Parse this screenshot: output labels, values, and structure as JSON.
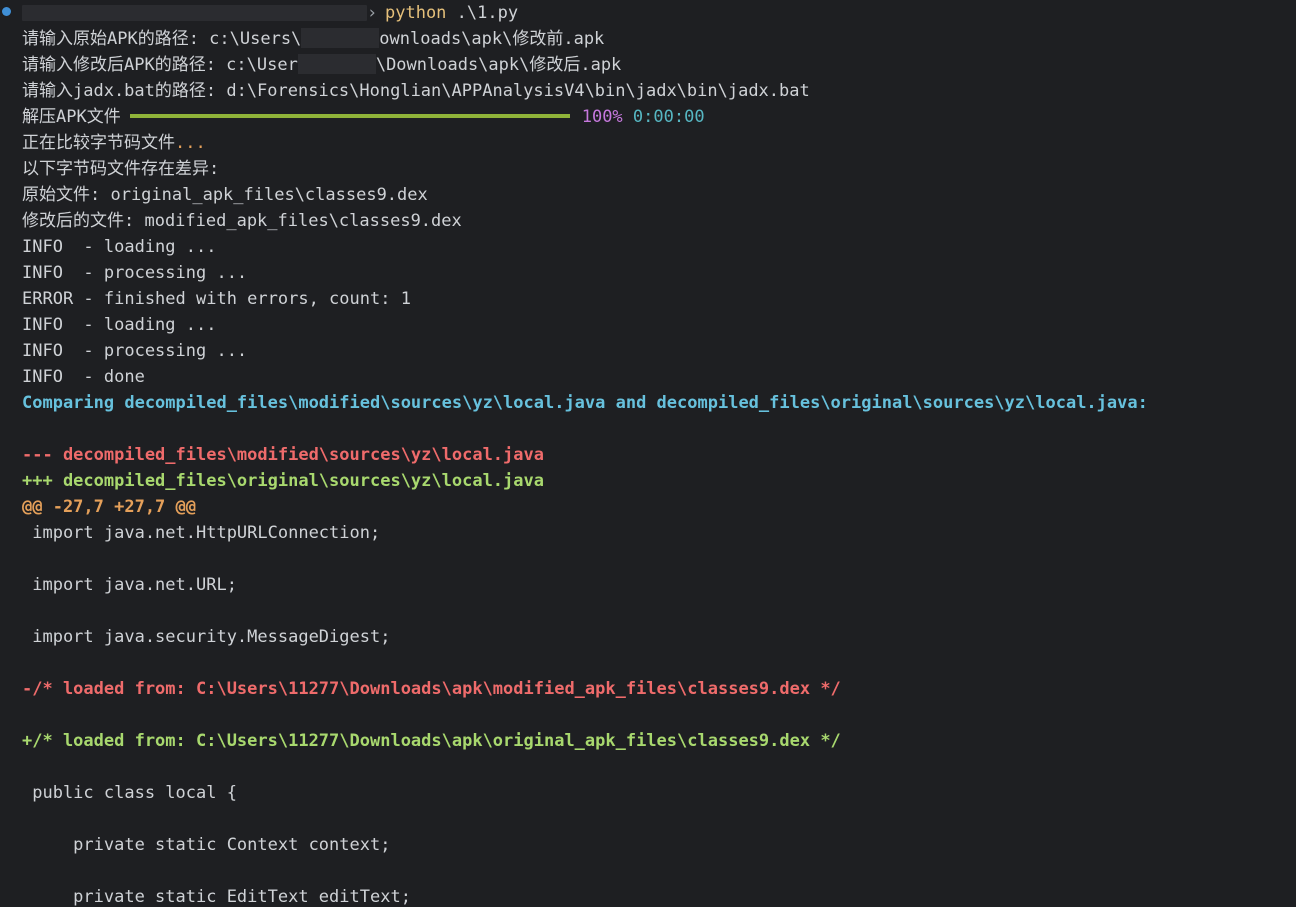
{
  "prompt": {
    "command_exe": "python",
    "command_args": " .\\1.py"
  },
  "inputs": {
    "original_label": "请输入原始APK的路径: c:\\Users\\",
    "original_tail": "ownloads\\apk\\修改前.apk",
    "modified_label": "请输入修改后APK的路径: c:\\User",
    "modified_tail": "\\Downloads\\apk\\修改后.apk",
    "jadx_line": "请输入jadx.bat的路径: d:\\Forensics\\Honglian\\APPAnalysisV4\\bin\\jadx\\bin\\jadx.bat"
  },
  "progress": {
    "label": "解压APK文件",
    "percent_text": "100%",
    "elapsed": "0:00:00",
    "fraction": 1.0
  },
  "status": {
    "comparing_text": "正在比较字节码文件",
    "comparing_ellipsis": "...",
    "diff_found": "以下字节码文件存在差异:",
    "original_file": "原始文件: original_apk_files\\classes9.dex",
    "modified_file": "修改后的文件: modified_apk_files\\classes9.dex"
  },
  "log": [
    "INFO  - loading ...",
    "INFO  - processing ...",
    "ERROR - finished with errors, count: 1",
    "INFO  - loading ...",
    "INFO  - processing ...",
    "INFO  - done"
  ],
  "diff": {
    "comparing_header": "Comparing decompiled_files\\modified\\sources\\yz\\local.java and decompiled_files\\original\\sources\\yz\\local.java:",
    "minus_file": "--- decompiled_files\\modified\\sources\\yz\\local.java",
    "plus_file": "+++ decompiled_files\\original\\sources\\yz\\local.java",
    "hunk": "@@ -27,7 +27,7 @@",
    "ctx1": " import java.net.HttpURLConnection;",
    "ctx2": " import java.net.URL;",
    "ctx3": " import java.security.MessageDigest;",
    "removed": "-/* loaded from: C:\\Users\\11277\\Downloads\\apk\\modified_apk_files\\classes9.dex */",
    "added": "+/* loaded from: C:\\Users\\11277\\Downloads\\apk\\original_apk_files\\classes9.dex */",
    "ctx4": " public class local {",
    "ctx5": "     private static Context context;",
    "ctx6": "     private static EditText editText;"
  },
  "colors": {
    "background": "#1e1f22",
    "text": "#cfd2d6",
    "command": "#e5c07b",
    "percent": "#c678dd",
    "elapsed": "#56b6c2",
    "progress_bar": "#8fb339",
    "diff_header": "#67c1dd",
    "diff_minus": "#ef6b6b",
    "diff_plus": "#a8d86e",
    "hunk": "#e5a05a"
  }
}
